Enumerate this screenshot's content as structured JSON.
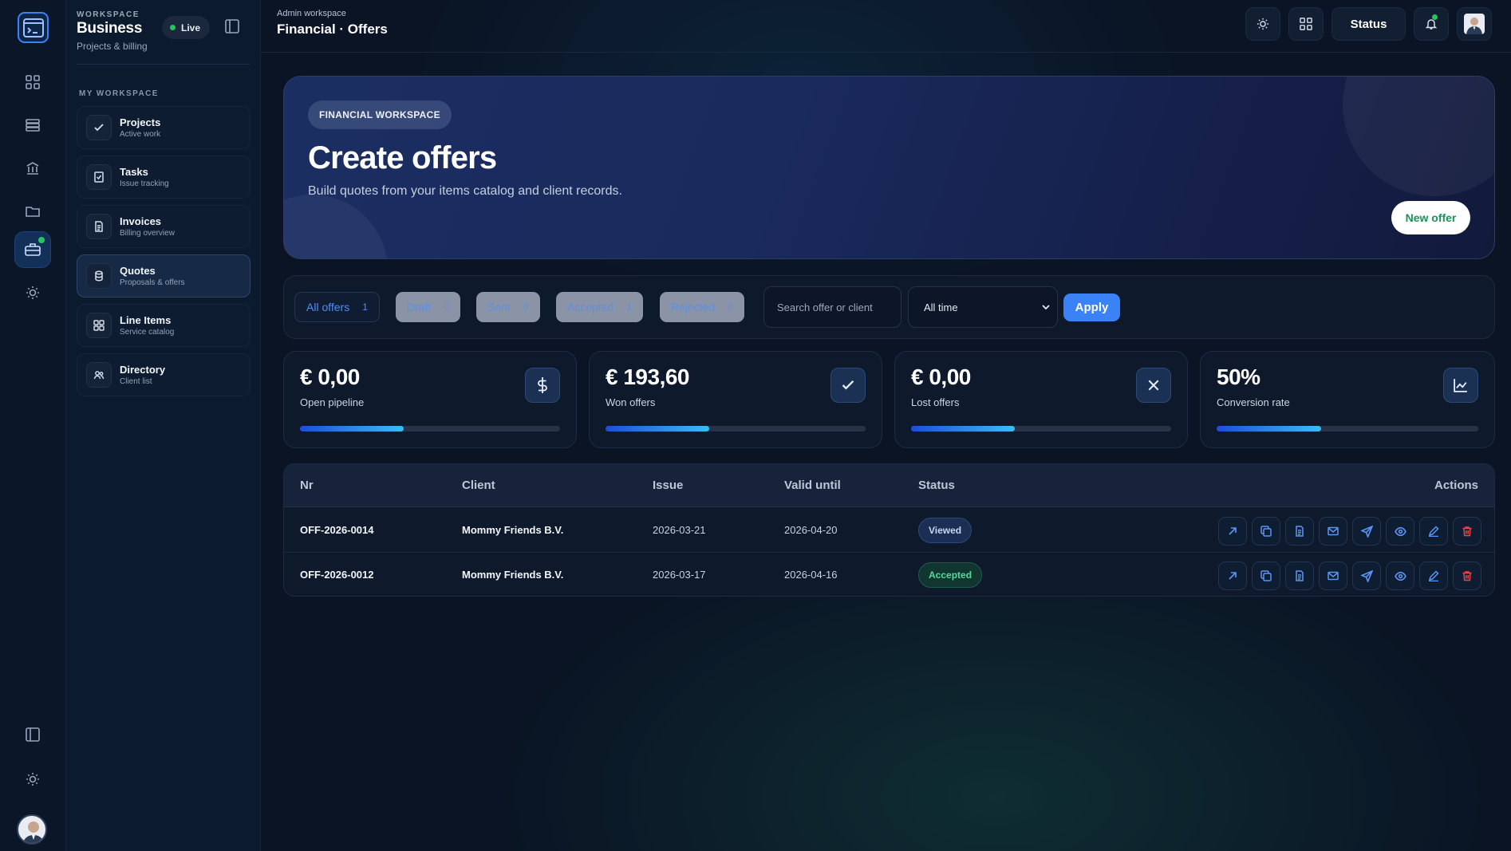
{
  "workspace": {
    "kicker": "WORKSPACE",
    "name": "Business",
    "subtitle": "Projects & billing",
    "live": "Live"
  },
  "sidebar": {
    "section_title": "MY WORKSPACE",
    "items": [
      {
        "label": "Projects",
        "sub": "Active work",
        "icon": "check-icon"
      },
      {
        "label": "Tasks",
        "sub": "Issue tracking",
        "icon": "checklist-icon"
      },
      {
        "label": "Invoices",
        "sub": "Billing overview",
        "icon": "document-icon"
      },
      {
        "label": "Quotes",
        "sub": "Proposals & offers",
        "icon": "database-icon",
        "active": true
      },
      {
        "label": "Line Items",
        "sub": "Service catalog",
        "icon": "grid-icon"
      },
      {
        "label": "Directory",
        "sub": "Client list",
        "icon": "users-icon"
      }
    ]
  },
  "rail": {
    "icons": [
      "terminal-icon",
      "grid-icon",
      "server-icon",
      "bank-icon",
      "folder-icon",
      "briefcase-icon",
      "sun-icon",
      "panel-icon",
      "settings-icon"
    ]
  },
  "header": {
    "breadcrumb": "Admin workspace",
    "title": "Financial · Offers",
    "status_label": "Status"
  },
  "hero": {
    "pill": "FINANCIAL WORKSPACE",
    "title": "Create offers",
    "subtitle": "Build quotes from your items catalog and client records.",
    "cta": "New offer"
  },
  "filters": {
    "chips": [
      {
        "label": "All offers",
        "count": "1"
      },
      {
        "label": "Draft",
        "count": "0"
      },
      {
        "label": "Sent",
        "count": "0"
      },
      {
        "label": "Accepted",
        "count": "1"
      },
      {
        "label": "Rejected",
        "count": "0"
      }
    ],
    "search_placeholder": "Search offer or client",
    "period": "All time",
    "apply": "Apply"
  },
  "stats": [
    {
      "value": "€ 0,00",
      "label": "Open pipeline",
      "icon": "dollar-icon",
      "progress": 0.4
    },
    {
      "value": "€ 193,60",
      "label": "Won offers",
      "icon": "check-icon",
      "progress": 0.4
    },
    {
      "value": "€ 0,00",
      "label": "Lost offers",
      "icon": "x-icon",
      "progress": 0.4
    },
    {
      "value": "50%",
      "label": "Conversion rate",
      "icon": "chart-icon",
      "progress": 0.4
    }
  ],
  "table": {
    "columns": [
      "Nr",
      "Client",
      "Issue",
      "Valid until",
      "Status",
      "Actions"
    ],
    "rows": [
      {
        "nr": "OFF-2026-0014",
        "client": "Mommy Friends B.V.",
        "issue": "2026-03-21",
        "valid": "2026-04-20",
        "status": "Viewed"
      },
      {
        "nr": "OFF-2026-0012",
        "client": "Mommy Friends B.V.",
        "issue": "2026-03-17",
        "valid": "2026-04-16",
        "status": "Accepted"
      }
    ],
    "actions": [
      "open-icon",
      "duplicate-icon",
      "pdf-icon",
      "mail-icon",
      "send-icon",
      "view-icon",
      "edit-icon",
      "delete-icon"
    ]
  },
  "colors": {
    "accent": "#3b82f6",
    "success": "#22c55e",
    "danger": "#ef4444",
    "background": "#0a1424"
  }
}
